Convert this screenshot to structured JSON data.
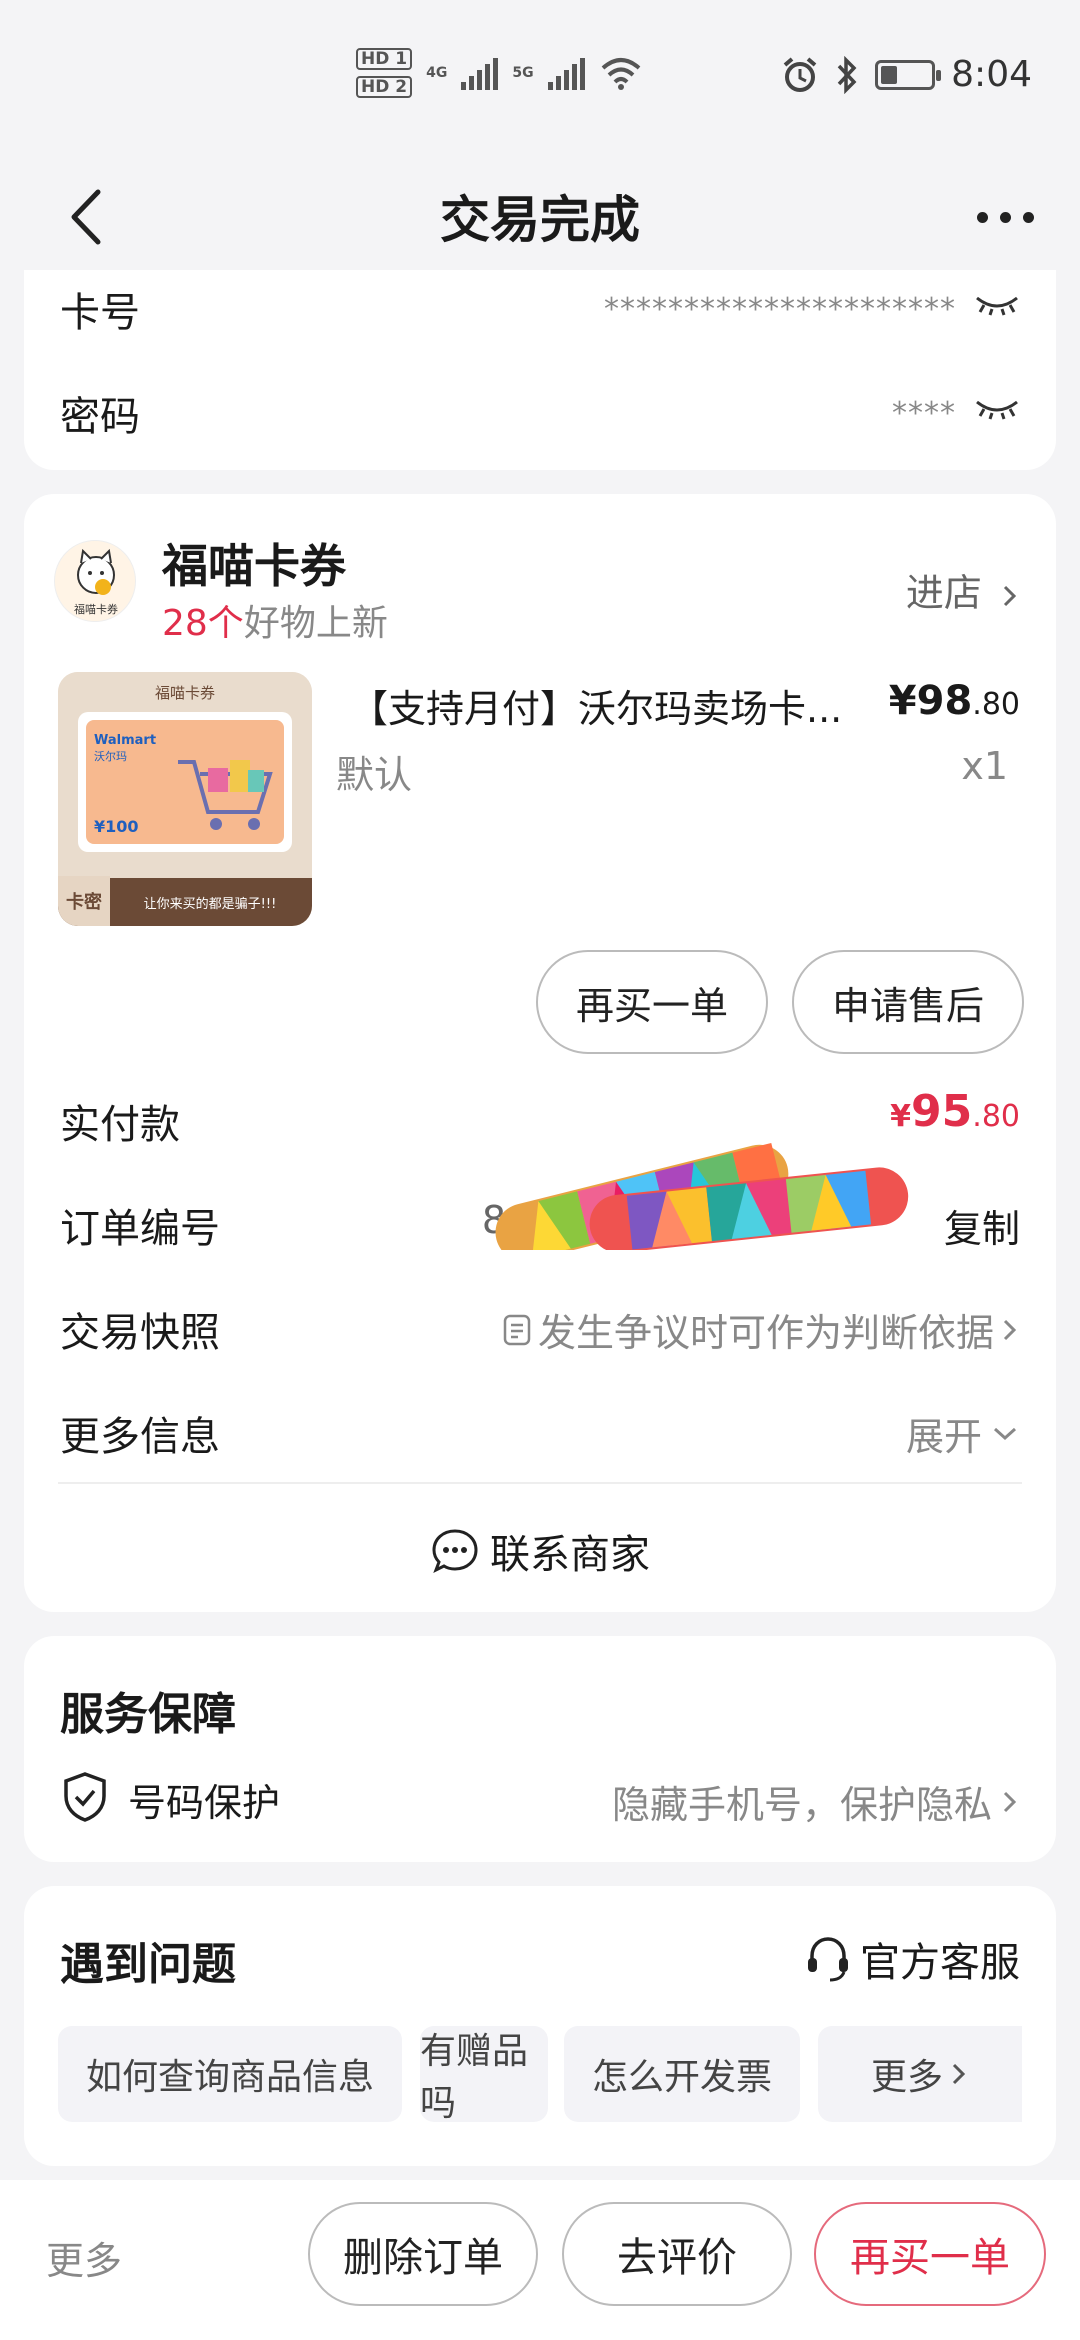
{
  "status_bar": {
    "hd1": "HD 1",
    "hd2": "HD 2",
    "net1": "4G",
    "net2": "5G",
    "time": "8:04"
  },
  "header": {
    "title": "交易完成"
  },
  "credentials": {
    "card_label": "卡号",
    "card_value": "**********************",
    "password_label": "密码",
    "password_value": "****"
  },
  "shop": {
    "name": "福喵卡券",
    "logo_text": "福喵卡券",
    "new_count": "28个",
    "new_suffix": "好物上新",
    "enter_label": "进店"
  },
  "product": {
    "thumb_header": "福喵卡券",
    "thumb_brand": "Walmart",
    "thumb_brand_cn": "沃尔玛",
    "thumb_amount": "¥100",
    "thumb_tag": "卡密",
    "thumb_banner": "让你来买的都是骗子!!!",
    "name": "【支持月付】沃尔玛卖场卡...",
    "price_main": "¥98",
    "price_dec": ".80",
    "spec": "默认",
    "qty": "x1"
  },
  "actions": {
    "rebuy": "再买一单",
    "after_sale": "申请售后"
  },
  "order": {
    "paid_label": "实付款",
    "paid_yen": "¥",
    "paid_main": "95",
    "paid_dec": ".80",
    "order_no_label": "订单编号",
    "order_no_visible": "8",
    "copy_label": "复制",
    "snapshot_label": "交易快照",
    "snapshot_value": "发生争议时可作为判断依据",
    "more_info_label": "更多信息",
    "expand_label": "展开"
  },
  "contact": {
    "label": "联系商家"
  },
  "service": {
    "title": "服务保障",
    "item_label": "号码保护",
    "item_value": "隐藏手机号，保护隐私"
  },
  "problems": {
    "title": "遇到问题",
    "official_service": "官方客服",
    "chips": [
      "如何查询商品信息",
      "有赠品吗",
      "怎么开发票"
    ],
    "more": "更多"
  },
  "bottom": {
    "more": "更多",
    "delete_order": "删除订单",
    "review": "去评价",
    "rebuy": "再买一单"
  },
  "colors": {
    "accent_red": "#e02e4a",
    "background": "#f4f4f6"
  }
}
